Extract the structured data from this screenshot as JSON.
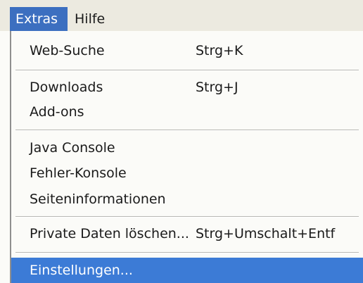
{
  "menubar": {
    "items": [
      {
        "label": "Extras",
        "active": true
      },
      {
        "label": "Hilfe",
        "active": false
      }
    ]
  },
  "dropdown": {
    "items": [
      {
        "label": "Web-Suche",
        "shortcut": "Strg+K"
      },
      {
        "label": "Downloads",
        "shortcut": "Strg+J"
      },
      {
        "label": "Add-ons",
        "shortcut": ""
      },
      {
        "label": "Java Console",
        "shortcut": ""
      },
      {
        "label": "Fehler-Konsole",
        "shortcut": ""
      },
      {
        "label": "Seiteninformationen",
        "shortcut": ""
      },
      {
        "label": "Private Daten löschen...",
        "shortcut": "Strg+Umschalt+Entf"
      },
      {
        "label": "Einstellungen...",
        "shortcut": "",
        "highlighted": true
      }
    ]
  },
  "colors": {
    "menu_highlight": "#3c7bd6",
    "menubar_active": "#3c6fc0",
    "menu_background": "#fbfbf8",
    "menubar_background": "#eceae0"
  }
}
